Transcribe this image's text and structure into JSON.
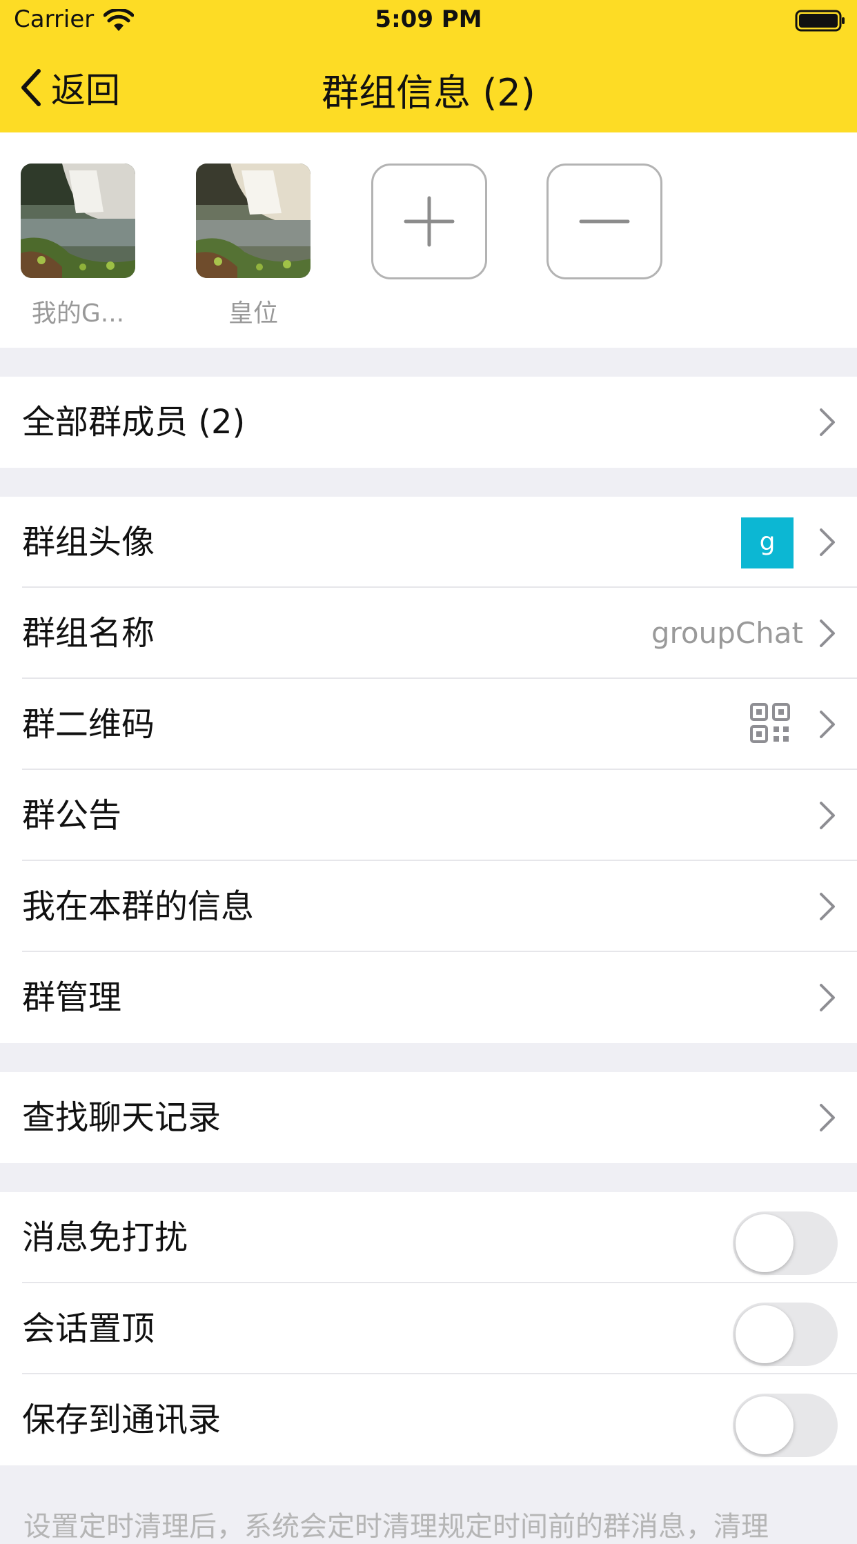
{
  "status_bar": {
    "carrier": "Carrier",
    "time": "5:09 PM"
  },
  "nav": {
    "back_label": "返回",
    "title": "群组信息 (2)"
  },
  "members": [
    {
      "name": "我的G..."
    },
    {
      "name": "皇位"
    }
  ],
  "all_members": {
    "label": "全部群成员 (2)"
  },
  "group_settings": {
    "avatar_label": "群组头像",
    "avatar_letter": "g",
    "name_label": "群组名称",
    "name_value": "groupChat",
    "qr_label": "群二维码",
    "notice_label": "群公告",
    "my_info_label": "我在本群的信息",
    "manage_label": "群管理"
  },
  "search": {
    "label": "查找聊天记录"
  },
  "toggles": [
    {
      "label": "消息免打扰",
      "on": false
    },
    {
      "label": "会话置顶",
      "on": false
    },
    {
      "label": "保存到通讯录",
      "on": false
    }
  ],
  "footer_note": "设置定时清理后，系统会定时清理规定时间前的群消息，清理",
  "colors": {
    "header": "#fddc25",
    "group_avatar": "#0cb7d3",
    "background": "#efeff4"
  }
}
